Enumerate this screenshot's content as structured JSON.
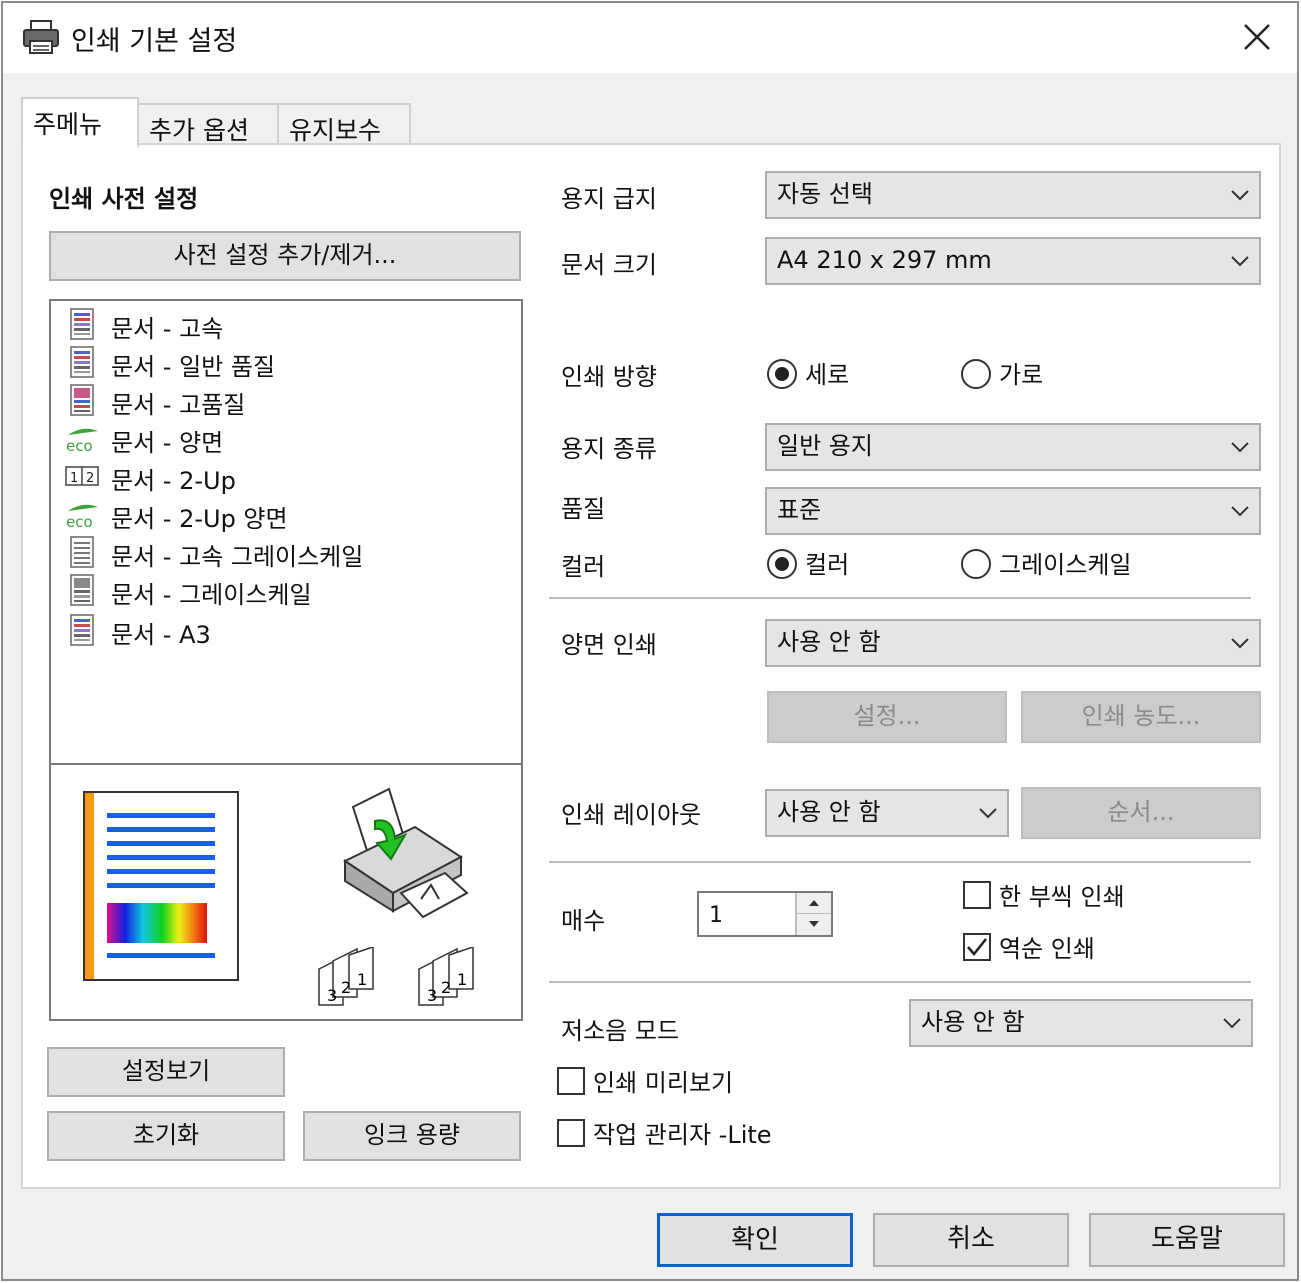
{
  "window": {
    "title": "인쇄 기본 설정"
  },
  "tabs": [
    {
      "label": "주메뉴",
      "active": true
    },
    {
      "label": "추가 옵션",
      "active": false
    },
    {
      "label": "유지보수",
      "active": false
    }
  ],
  "presets": {
    "heading": "인쇄 사전 설정",
    "add_remove_button": "사전 설정 추가/제거...",
    "items": [
      {
        "label": "문서 - 고속",
        "icon": "document-color-icon"
      },
      {
        "label": "문서 - 일반 품질",
        "icon": "document-color-icon"
      },
      {
        "label": "문서 - 고품질",
        "icon": "document-photo-icon"
      },
      {
        "label": "문서 - 양면",
        "icon": "eco-icon"
      },
      {
        "label": "문서 - 2-Up",
        "icon": "two-up-icon"
      },
      {
        "label": "문서 - 2-Up 양면",
        "icon": "eco-icon"
      },
      {
        "label": "문서 - 고속 그레이스케일",
        "icon": "document-gray-icon"
      },
      {
        "label": "문서 - 그레이스케일",
        "icon": "document-gray-photo-icon"
      },
      {
        "label": "문서 - A3",
        "icon": "document-color-icon"
      }
    ]
  },
  "preview": {
    "stack_left": [
      "3",
      "2",
      "1"
    ],
    "stack_right": [
      "3",
      "2",
      "1"
    ]
  },
  "left_buttons": {
    "show_settings": "설정보기",
    "reset": "초기화",
    "ink_levels": "잉크 용량"
  },
  "settings": {
    "paper_source": {
      "label": "용지 급지",
      "value": "자동 선택"
    },
    "document_size": {
      "label": "문서 크기",
      "value": "A4 210 x 297 mm"
    },
    "orientation": {
      "label": "인쇄 방향",
      "options": [
        "세로",
        "가로"
      ],
      "selected": "세로"
    },
    "paper_type": {
      "label": "용지 종류",
      "value": "일반 용지"
    },
    "quality": {
      "label": "품질",
      "value": "표준"
    },
    "color": {
      "label": "컬러",
      "options": [
        "컬러",
        "그레이스케일"
      ],
      "selected": "컬러"
    },
    "duplex": {
      "label": "양면 인쇄",
      "value": "사용 안 함",
      "settings_button": "설정...",
      "density_button": "인쇄 농도..."
    },
    "layout": {
      "label": "인쇄 레이아웃",
      "value": "사용 안 함",
      "order_button": "순서..."
    },
    "copies": {
      "label": "매수",
      "value": "1",
      "collate": {
        "label": "한 부씩 인쇄",
        "checked": false
      },
      "reverse": {
        "label": "역순 인쇄",
        "checked": true
      }
    },
    "quiet_mode": {
      "label": "저소음 모드",
      "value": "사용 안 함"
    },
    "print_preview": {
      "label": "인쇄 미리보기",
      "checked": false
    },
    "job_arranger": {
      "label": "작업 관리자 -Lite",
      "checked": false
    }
  },
  "footer": {
    "ok": "확인",
    "cancel": "취소",
    "help": "도움말"
  },
  "colors": {
    "accent_blue": "#0b62c8",
    "panel_bg": "#ffffff",
    "window_bg": "#f0f0f0",
    "button_bg": "#e1e1e1"
  }
}
